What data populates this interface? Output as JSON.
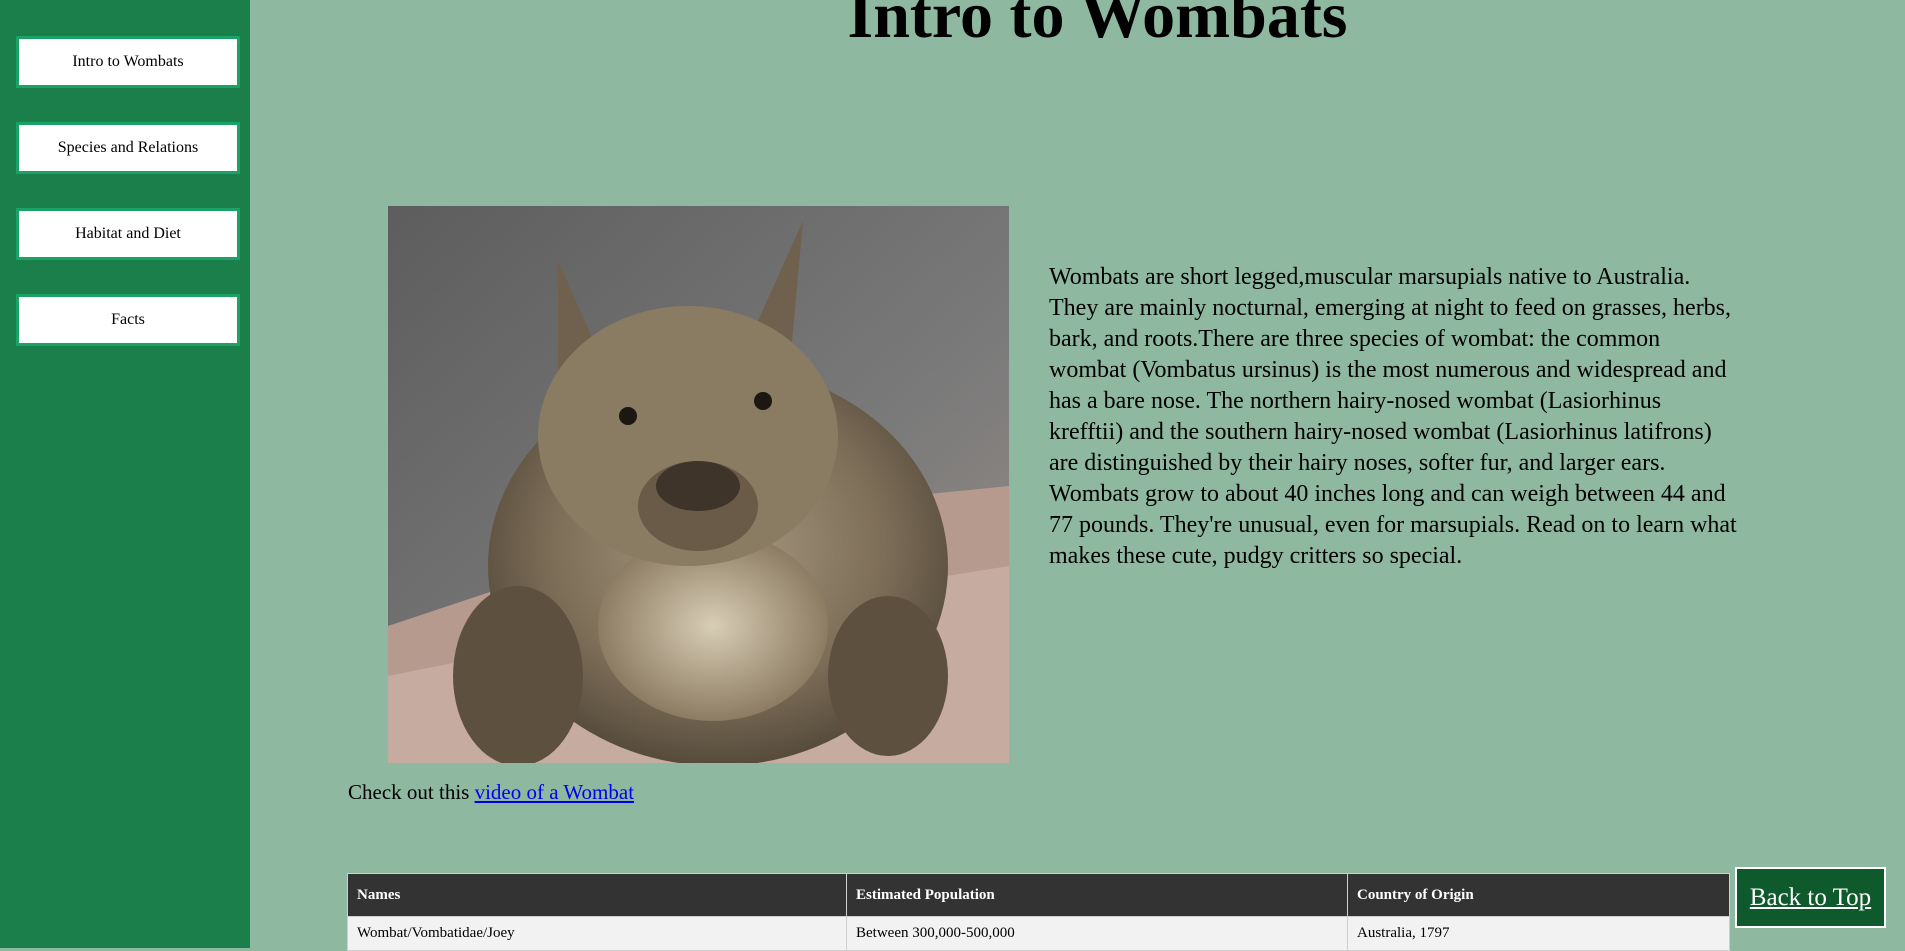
{
  "sidebar": {
    "items": [
      {
        "label": "Intro to Wombats"
      },
      {
        "label": "Species and Relations"
      },
      {
        "label": "Habitat and Diet"
      },
      {
        "label": "Facts"
      }
    ]
  },
  "main": {
    "title": "Intro to Wombats",
    "intro": "Wombats are short legged,muscular marsupials native to Australia. They are mainly nocturnal, emerging at night to feed on grasses, herbs, bark, and roots.There are three species of wombat: the common wombat (Vombatus ursinus) is the most numerous and widespread and has a bare nose. The northern hairy-nosed wombat (Lasiorhinus krefftii) and the southern hairy-nosed wombat (Lasiorhinus latifrons) are distinguished by their hairy noses, softer fur, and larger ears. Wombats grow to about 40 inches long and can weigh between 44 and 77 pounds. They're unusual, even for marsupials. Read on to learn what makes these cute, pudgy critters so special.",
    "video_prefix": "Check out this ",
    "video_link": "video of a Wombat"
  },
  "table": {
    "headers": [
      "Names",
      "Estimated Population",
      "Country of Origin"
    ],
    "rows": [
      [
        "Wombat/Vombatidae/Joey",
        "Between 300,000-500,000",
        "Australia, 1797"
      ]
    ]
  },
  "back_to_top": "Back to Top",
  "colors": {
    "sidebar": "#1b7f4b",
    "page_background": "#8fb8a1",
    "nav_border": "#1aa364",
    "table_header": "#333333",
    "back_to_top": "#0f5a2c",
    "link": "#0000ee"
  }
}
